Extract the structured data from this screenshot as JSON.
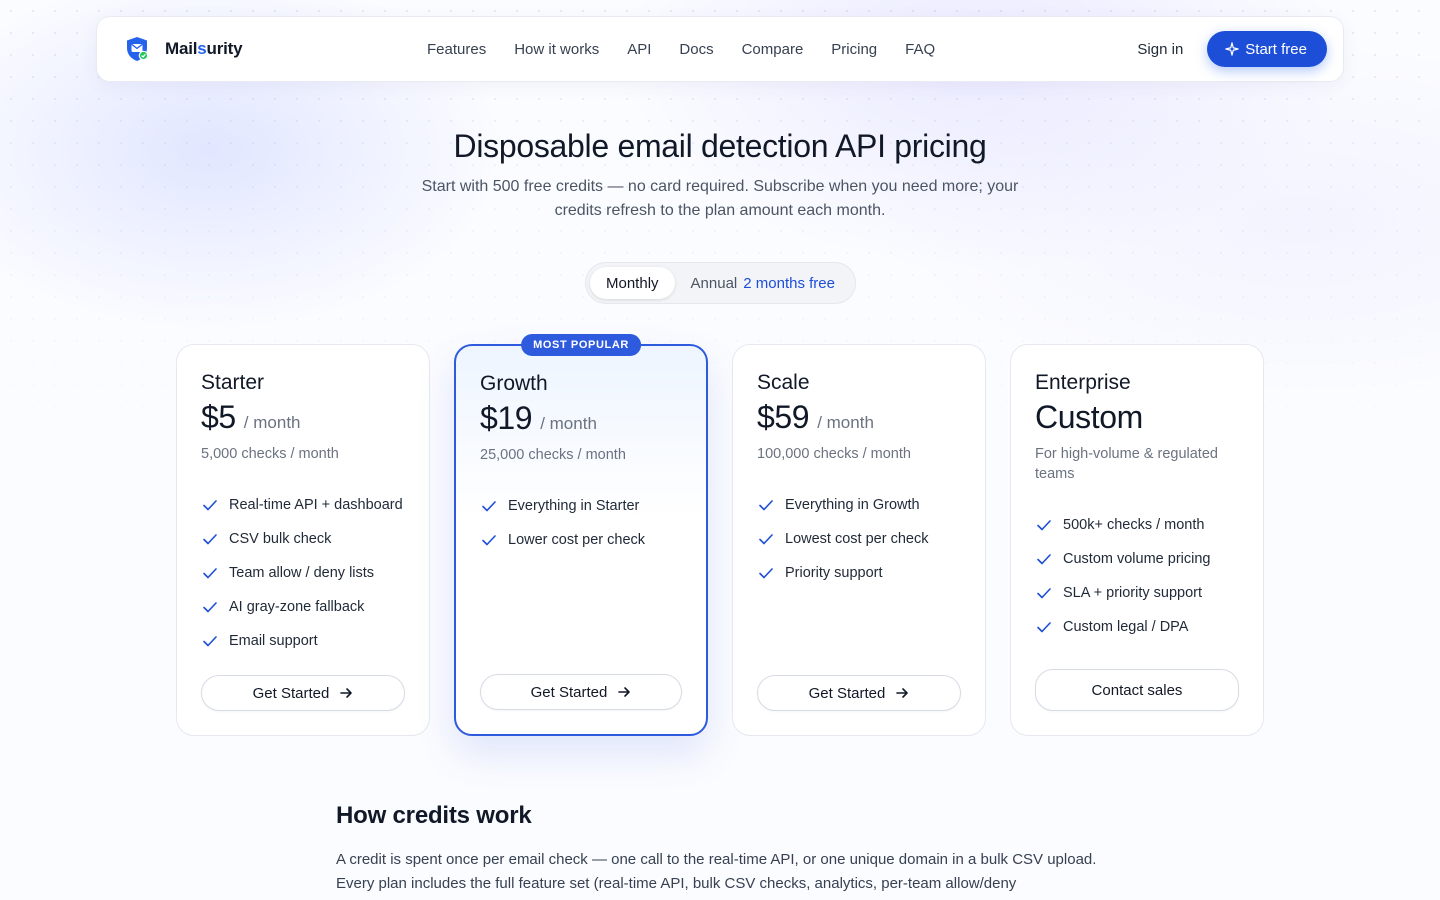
{
  "nav": {
    "brand_prefix": "Mail",
    "brand_accent": "s",
    "brand_suffix": "urity",
    "links": [
      "Features",
      "How it works",
      "API",
      "Docs",
      "Compare",
      "Pricing",
      "FAQ"
    ],
    "sign_in": "Sign in",
    "start_free": "Start free"
  },
  "hero": {
    "title": "Disposable email detection API pricing",
    "subtitle": "Start with 500 free credits — no card required. Subscribe when you need more; your credits refresh to the plan amount each month."
  },
  "billing_toggle": {
    "monthly": "Monthly",
    "annual": "Annual",
    "annual_badge": "2 months free",
    "selected": "Monthly"
  },
  "plans": [
    {
      "name": "Starter",
      "price": "$5",
      "period": "/ month",
      "checks": "5,000 checks / month",
      "features": [
        "Real-time API + dashboard",
        "CSV bulk check",
        "Team allow / deny lists",
        "AI gray-zone fallback",
        "Email support"
      ],
      "cta": "Get Started"
    },
    {
      "name": "Growth",
      "badge": "MOST POPULAR",
      "price": "$19",
      "period": "/ month",
      "checks": "25,000 checks / month",
      "features": [
        "Everything in Starter",
        "Lower cost per check"
      ],
      "cta": "Get Started"
    },
    {
      "name": "Scale",
      "price": "$59",
      "period": "/ month",
      "checks": "100,000 checks / month",
      "features": [
        "Everything in Growth",
        "Lowest cost per check",
        "Priority support"
      ],
      "cta": "Get Started"
    },
    {
      "name": "Enterprise",
      "price": "Custom",
      "checks": "For high-volume & regulated teams",
      "features": [
        "500k+ checks / month",
        "Custom volume pricing",
        "SLA + priority support",
        "Custom legal / DPA"
      ],
      "cta": "Contact sales"
    }
  ],
  "credits": {
    "title": "How credits work",
    "body": "A credit is spent once per email check — one call to the real-time API, or one unique domain in a bulk CSV upload. Every plan includes the full feature set (real-time API, bulk CSV checks, analytics, per-team allow/deny"
  },
  "colors": {
    "accent": "#1d4ed8",
    "popular_border": "#2e5bde",
    "check": "#1d4ed8"
  }
}
